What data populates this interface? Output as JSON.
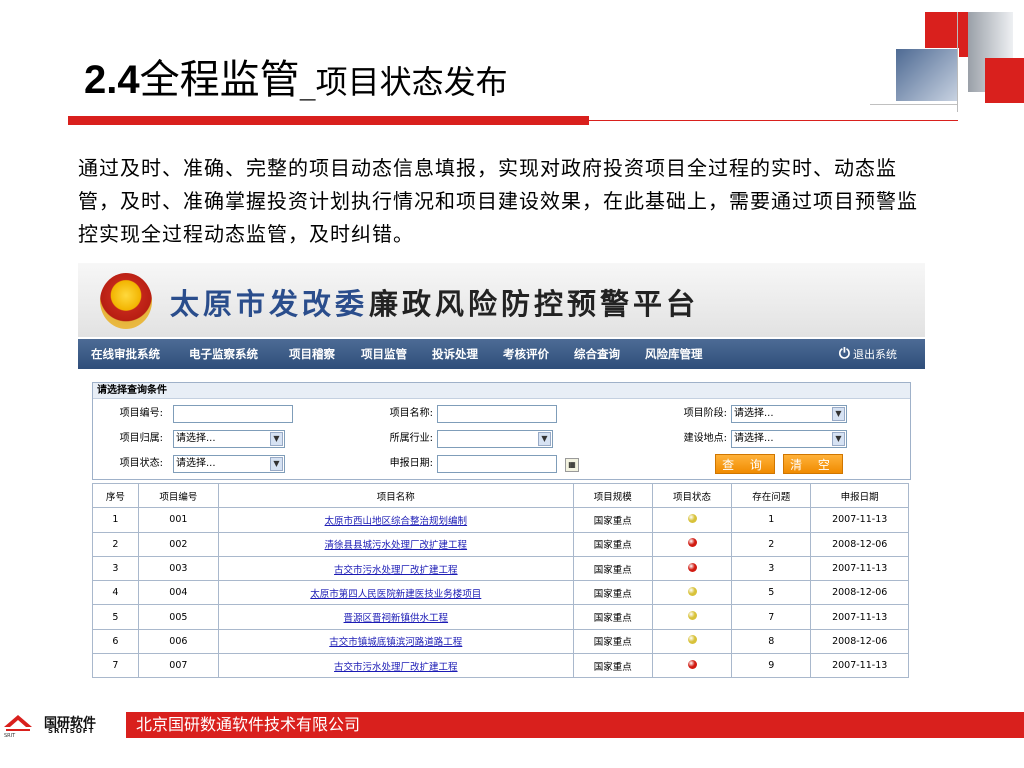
{
  "slide": {
    "title_num": "2.4",
    "title_main": "全程监管",
    "title_sub": "_项目状态发布",
    "paragraph": "通过及时、准确、完整的项目动态信息填报，实现对政府投资项目全过程的实时、动态监管，及时、准确掌握投资计划执行情况和项目建设效果，在此基础上，需要通过项目预警监控实现全过程动态监管，及时纠错。"
  },
  "app": {
    "banner_title_blue": "太原市发改委",
    "banner_title_dark": "廉政风险防控预警平台",
    "nav": [
      "在线审批系统",
      "电子监察系统",
      "项目稽察",
      "项目监管",
      "投诉处理",
      "考核评价",
      "综合查询",
      "风险库管理"
    ],
    "logout_label": "退出系统",
    "query": {
      "header": "请选择查询条件",
      "fields": {
        "project_no": {
          "label": "项目编号:",
          "value": ""
        },
        "project_name": {
          "label": "项目名称:",
          "value": ""
        },
        "project_stage": {
          "label": "项目阶段:",
          "value": "请选择..."
        },
        "project_owner": {
          "label": "项目归属:",
          "value": "请选择..."
        },
        "industry": {
          "label": "所属行业:",
          "value": ""
        },
        "location": {
          "label": "建设地点:",
          "value": "请选择..."
        },
        "project_status": {
          "label": "项目状态:",
          "value": "请选择..."
        },
        "report_date": {
          "label": "申报日期:",
          "value": ""
        }
      },
      "search_button": "查 询",
      "clear_button": "清 空"
    },
    "table": {
      "headers": [
        "序号",
        "项目编号",
        "项目名称",
        "项目规模",
        "项目状态",
        "存在问题",
        "申报日期"
      ],
      "rows": [
        {
          "seq": "1",
          "code": "001",
          "name": "太原市西山地区综合整治规划编制",
          "scale": "国家重点",
          "status": "yellow",
          "issues": "1",
          "date": "2007-11-13"
        },
        {
          "seq": "2",
          "code": "002",
          "name": "清徐县县城污水处理厂改扩建工程",
          "scale": "国家重点",
          "status": "red",
          "issues": "2",
          "date": "2008-12-06"
        },
        {
          "seq": "3",
          "code": "003",
          "name": "古交市污水处理厂改扩建工程",
          "scale": "国家重点",
          "status": "red",
          "issues": "3",
          "date": "2007-11-13"
        },
        {
          "seq": "4",
          "code": "004",
          "name": "太原市第四人民医院新建医技业务楼项目",
          "scale": "国家重点",
          "status": "yellow",
          "issues": "5",
          "date": "2008-12-06"
        },
        {
          "seq": "5",
          "code": "005",
          "name": "晋源区晋祠新镇供水工程",
          "scale": "国家重点",
          "status": "yellow",
          "issues": "7",
          "date": "2007-11-13"
        },
        {
          "seq": "6",
          "code": "006",
          "name": "古交市镇城底镇滨河路道路工程",
          "scale": "国家重点",
          "status": "yellow",
          "issues": "8",
          "date": "2008-12-06"
        },
        {
          "seq": "7",
          "code": "007",
          "name": "古交市污水处理厂改扩建工程",
          "scale": "国家重点",
          "status": "red",
          "issues": "9",
          "date": "2007-11-13"
        }
      ]
    }
  },
  "footer": {
    "logo_cn": "国研软件",
    "logo_en": "SRITSOFT",
    "logo_small": "SRIT",
    "company": "北京国研数通软件技术有限公司"
  },
  "colors": {
    "accent_red": "#d9201d",
    "nav_blue": "#3a5985",
    "status_red": "#d11b12",
    "status_yellow": "#d8c23a"
  }
}
